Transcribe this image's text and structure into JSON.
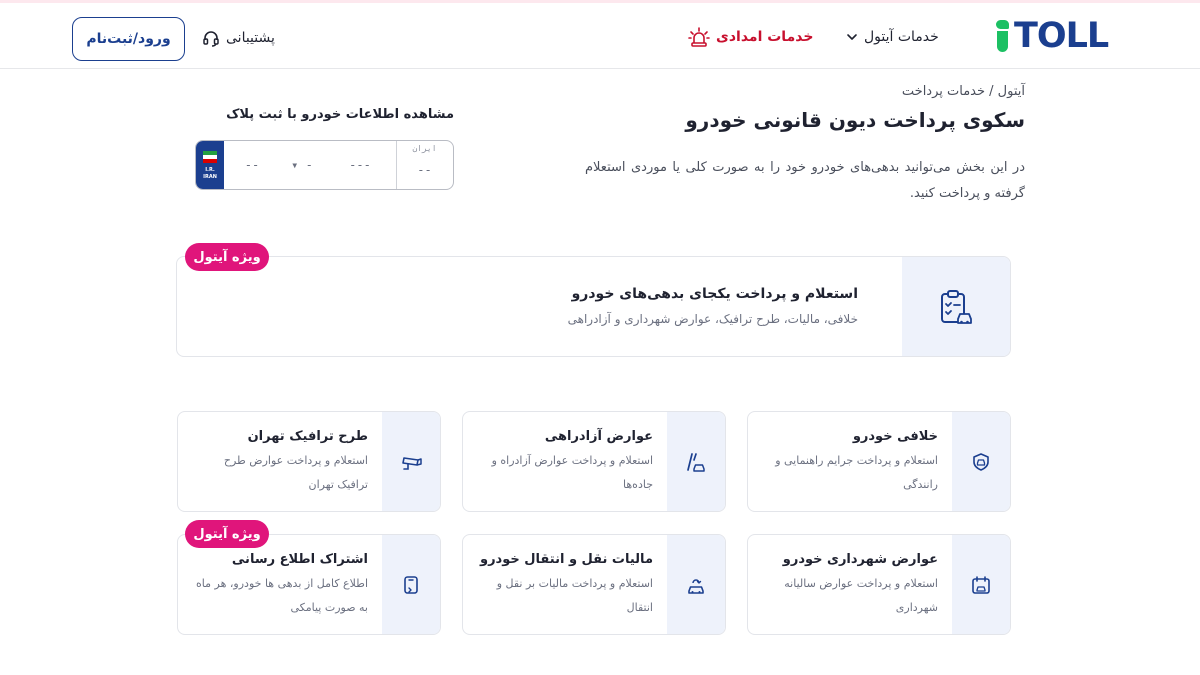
{
  "header": {
    "logo_text": "TOLL",
    "services_label": "خدمات آیتول",
    "emergency_label": "خدمات امدادی",
    "support_label": "پشتیبانی",
    "login_label": "ورود/ثبت‌نام"
  },
  "intro": {
    "breadcrumb": "آیتول / خدمات پرداخت",
    "title": "سکوی پرداخت دیون قانونی خودرو",
    "description": "در این بخش می‌توانید بدهی‌های خودرو خود را به صورت کلی یا موردی استعلام گرفته و پرداخت کنید."
  },
  "plate": {
    "title": "مشاهده اطلاعات خودرو با ثبت پلاک",
    "country_label": "ایران",
    "band_text": "I.R. IRAN",
    "seg_a": "--",
    "seg_b": "▾ -",
    "seg_c": "---",
    "seg_d": "--"
  },
  "featured": {
    "badge": "ویژه آیتول",
    "title": "استعلام و پرداخت یکجای بدهی‌های خودرو",
    "subtitle": "خلافی، مالیات، طرح ترافیک، عوارض شهرداری و آزادراهی",
    "icon": "clipboard-car-icon"
  },
  "services": [
    {
      "title": "خلافی خودرو",
      "desc": "استعلام و پرداخت جرایم راهنمایی و رانندگی",
      "icon": "police-badge-icon"
    },
    {
      "title": "عوارض آزادراهی",
      "desc": "استعلام و پرداخت عوارض آزادراه و جاده‌ها",
      "icon": "road-car-icon"
    },
    {
      "title": "طرح ترافیک تهران",
      "desc": "استعلام و پرداخت عوارض طرح ترافیک تهران",
      "icon": "traffic-camera-icon"
    },
    {
      "title": "عوارض شهرداری خودرو",
      "desc": "استعلام و پرداخت عوارض سالیانه شهرداری",
      "icon": "calendar-car-icon"
    },
    {
      "title": "مالیات نقل و انتقال خودرو",
      "desc": "استعلام و پرداخت مالیات بر نقل و انتقال",
      "icon": "car-transfer-icon"
    },
    {
      "title": "اشتراک اطلاع رسانی",
      "desc": "اطلاع کامل از بدهی ها خودرو، هر ماه به صورت پیامکی",
      "icon": "phone-notify-icon",
      "badge": "ویژه آیتول"
    }
  ],
  "colors": {
    "brand_blue": "#1b3f8f",
    "brand_green": "#1cc063",
    "badge_pink": "#e0157b",
    "emergency_red": "#c8102e",
    "icon_bg": "#eef2fb"
  }
}
